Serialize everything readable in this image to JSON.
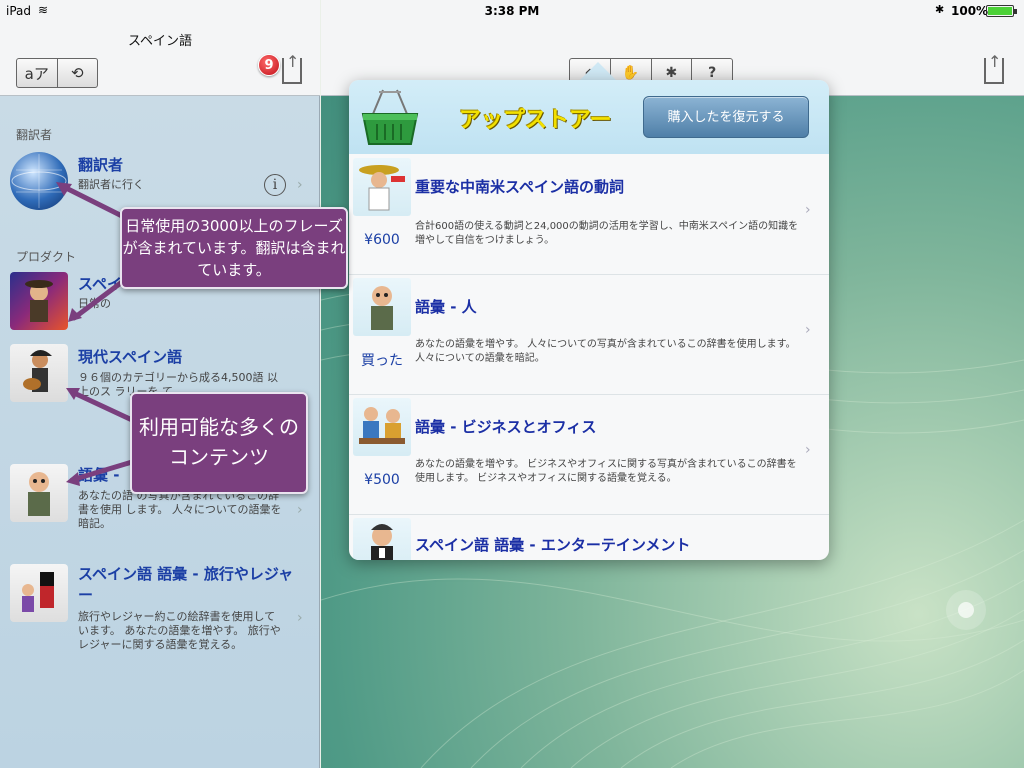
{
  "status_bar": {
    "device": "iPad",
    "time": "3:38 PM",
    "battery": "100%"
  },
  "sidebar": {
    "title": "スペイン語",
    "segment": [
      "aア",
      "⟲"
    ],
    "badge_count": "9",
    "section_translator": "翻訳者",
    "section_products": "プロダクト",
    "items": [
      {
        "title": "翻訳者",
        "desc": "翻訳者に行く"
      },
      {
        "title": "スペイ",
        "desc": "日常の"
      },
      {
        "title": "現代スペイン語",
        "desc": "９６個のカテゴリーから成る4,500語 以上のス ラリーを て"
      },
      {
        "title": "語彙 -",
        "desc": "あなたの語 の写真が含まれているこの辞書を使用 します。 人々についての語彙を暗記。"
      },
      {
        "title": "スペイン語 語彙 - 旅行やレジャー",
        "desc": "旅行やレジャー約この絵辞書を使用しています。 あなたの語彙を増やす。 旅行やレジャーに関する語彙を覚える。"
      }
    ]
  },
  "toolbar": {
    "segment": [
      "⌂",
      "✋",
      "✱",
      "?"
    ]
  },
  "store": {
    "title": "アップストアー",
    "restore_label": "購入したを復元する",
    "items": [
      {
        "title": "重要な中南米スペイン語の動詞",
        "price": "¥600",
        "desc": "合計600語の使える動詞と24,000の動詞の活用を学習し、中南米スペイン語の知識を増やして自信をつけましょう。"
      },
      {
        "title": "語彙 - 人",
        "price": "買った",
        "desc": "あなたの語彙を増やす。 人々についての写真が含まれているこの辞書を使用します。 人々についての語彙を暗記。"
      },
      {
        "title": "語彙 - ビジネスとオフィス",
        "price": "¥500",
        "desc": "あなたの語彙を増やす。 ビジネスやオフィスに関する写真が含まれているこの辞書を使用します。 ビジネスやオフィスに関する語彙を覚える。"
      },
      {
        "title": "スペイン語 語彙 - エンターテインメント",
        "price": "",
        "desc": ""
      }
    ]
  },
  "callouts": {
    "phrases": "日常使用の3000以上のフレーズが含まれています。翻訳は含まれています。",
    "content": "利用可能な多くのコンテンツ"
  },
  "colors": {
    "title_blue": "#1b3fa5",
    "callout_purple": "#7a3f7e",
    "store_title_yellow": "#f2e000",
    "restore_button": "#4f7fa8",
    "badge_red": "#c0101a"
  }
}
